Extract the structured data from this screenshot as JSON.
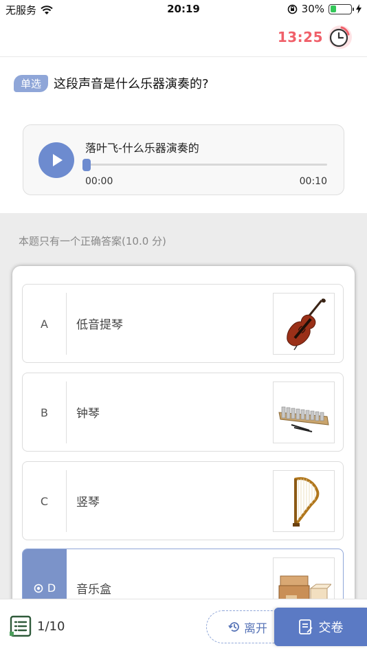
{
  "status_bar": {
    "carrier": "无服务",
    "time": "20:19",
    "battery_text": "30%",
    "battery_level": 0.3
  },
  "header": {
    "countdown": "13:25"
  },
  "question": {
    "type_tag": "单选",
    "text": "这段声音是什么乐器演奏的?"
  },
  "audio": {
    "title": "落叶飞-什么乐器演奏的",
    "current_time": "00:00",
    "total_time": "00:10",
    "progress": 0
  },
  "hint": "本题只有一个正确答案(10.0 分)",
  "options": [
    {
      "letter": "A",
      "label": "低音提琴",
      "icon": "double-bass-image",
      "selected": false
    },
    {
      "letter": "B",
      "label": "钟琴",
      "icon": "glockenspiel-image",
      "selected": false
    },
    {
      "letter": "C",
      "label": "竖琴",
      "icon": "harp-image",
      "selected": false
    },
    {
      "letter": "D",
      "label": "音乐盒",
      "icon": "music-box-image",
      "selected": true
    }
  ],
  "bottom_bar": {
    "page_indicator": "1/10",
    "leave_label": "离开",
    "submit_label": "交卷"
  },
  "colors": {
    "accent": "#6d8bcf",
    "timer": "#f0606a",
    "submit": "#5b7ac4"
  }
}
